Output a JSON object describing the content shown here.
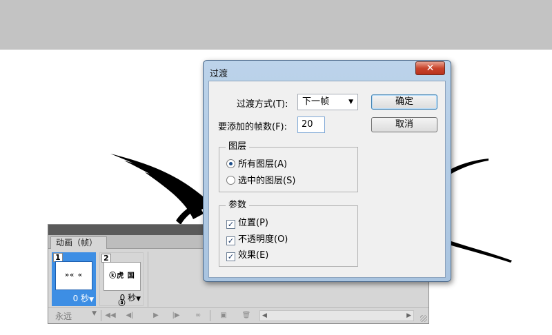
{
  "animation_panel": {
    "tab_label": "动画（帧）",
    "frames": [
      {
        "number": "1",
        "delay": "0 秒",
        "thumb_text": "»« «",
        "selected": true
      },
      {
        "number": "2",
        "delay": "0 秒",
        "thumb_text": "ⓚ虎 国 ⓐ",
        "selected": false
      }
    ],
    "loop_value": "永远",
    "dropdown_glyph": "▼",
    "toolbar_icons": [
      "first-frame-icon",
      "previous-frame-icon",
      "play-icon",
      "next-frame-icon",
      "tween-icon",
      "duplicate-frame-icon",
      "delete-frame-icon"
    ]
  },
  "dialog": {
    "title": "过渡",
    "close_glyph": "✕",
    "transition_mode_label": "过渡方式(T):",
    "transition_mode_value": "下一帧",
    "frames_to_add_label": "要添加的帧数(F):",
    "frames_to_add_value": "20",
    "ok_label": "确定",
    "cancel_label": "取消",
    "layers_group": {
      "title": "图层",
      "options": [
        {
          "label": "所有图层(A)",
          "checked": true
        },
        {
          "label": "选中的图层(S)",
          "checked": false
        }
      ]
    },
    "params_group": {
      "title": "参数",
      "options": [
        {
          "label": "位置(P)",
          "checked": true
        },
        {
          "label": "不透明度(O)",
          "checked": true
        },
        {
          "label": "效果(E)",
          "checked": true
        }
      ]
    }
  },
  "colors": {
    "top_band": "#c3c3c3",
    "selected_frame": "#3d8ee4",
    "close_button": "#c8442c"
  }
}
